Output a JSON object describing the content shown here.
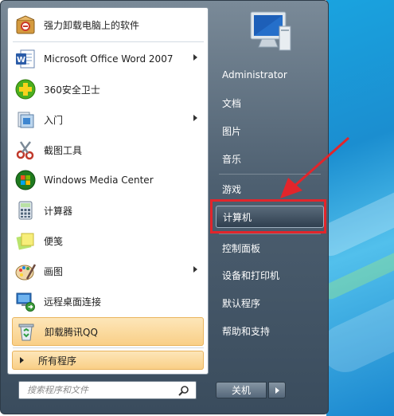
{
  "pinned": [
    {
      "label": "强力卸载电脑上的软件",
      "icon": "uninstaller-box-icon",
      "submenu": false
    },
    {
      "label": "Microsoft Office Word 2007",
      "icon": "word-icon",
      "submenu": true
    },
    {
      "label": "360安全卫士",
      "icon": "360-safe-icon",
      "submenu": false
    },
    {
      "label": "入门",
      "icon": "getting-started-icon",
      "submenu": true
    },
    {
      "label": "截图工具",
      "icon": "snipping-tool-icon",
      "submenu": false
    },
    {
      "label": "Windows Media Center",
      "icon": "media-center-icon",
      "submenu": false
    },
    {
      "label": "计算器",
      "icon": "calculator-icon",
      "submenu": false
    },
    {
      "label": "便笺",
      "icon": "sticky-notes-icon",
      "submenu": false
    },
    {
      "label": "画图",
      "icon": "paint-icon",
      "submenu": true
    },
    {
      "label": "远程桌面连接",
      "icon": "remote-desktop-icon",
      "submenu": false
    },
    {
      "label": "卸载腾讯QQ",
      "icon": "recycle-bin-icon",
      "submenu": false
    }
  ],
  "all_programs": "所有程序",
  "search": {
    "placeholder": "搜索程序和文件"
  },
  "right": {
    "items": [
      {
        "label": "Administrator"
      },
      {
        "label": "文档"
      },
      {
        "label": "图片"
      },
      {
        "label": "音乐"
      },
      {
        "label": "游戏"
      },
      {
        "label": "计算机"
      },
      {
        "label": "控制面板"
      },
      {
        "label": "设备和打印机"
      },
      {
        "label": "默认程序"
      },
      {
        "label": "帮助和支持"
      }
    ]
  },
  "shutdown": {
    "label": "关机"
  },
  "colors": {
    "highlight_box": "#e2252b",
    "hover_bg": "#f9cf87"
  }
}
